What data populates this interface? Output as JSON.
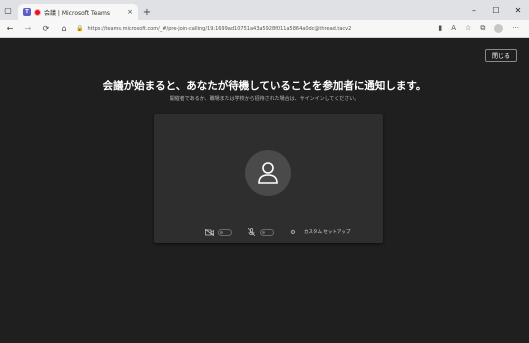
{
  "browser": {
    "tab_title": "会議 | Microsoft Teams",
    "tab_close": "×",
    "new_tab": "+",
    "url": "https://teams.microsoft.com/_#/pre-join-calling/19:1699ad10751a43a5928f011a5864a0dc@thread.tacv2"
  },
  "page": {
    "close_label": "閉じる",
    "headline": "会議が始まると、あなたが待機していることを参加者に通知します。",
    "subline": "開催者であるか、職場または学校から招待された場合は、サインインしてください。"
  },
  "controls": {
    "setup_label": "カスタム セットアップ"
  },
  "colors": {
    "background": "#1f1f1f",
    "preview": "#2e2e2e",
    "avatar": "#4a4a4a",
    "teams_brand": "#5b5fc7"
  }
}
